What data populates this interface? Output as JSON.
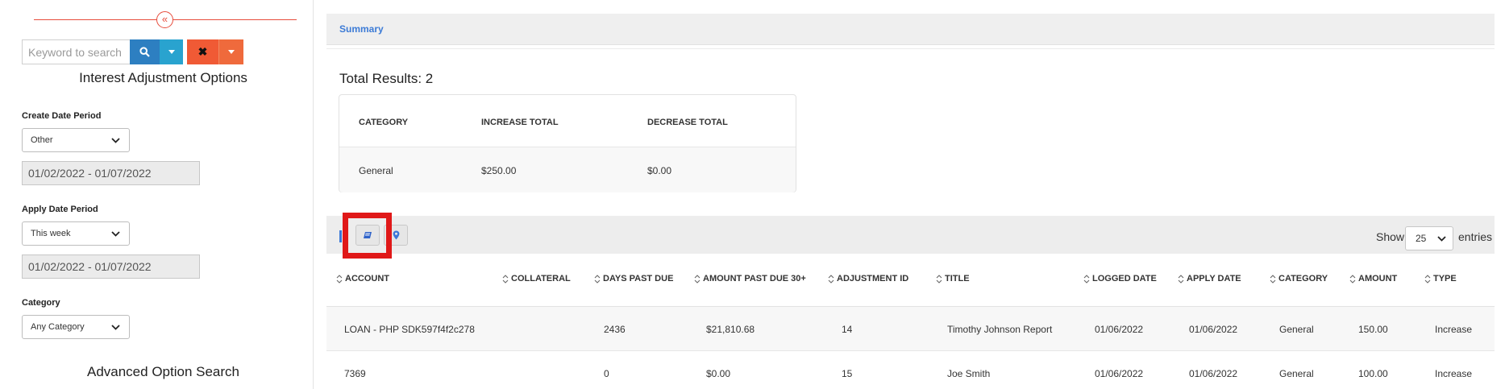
{
  "sidebar": {
    "collapse_glyph": "«",
    "search": {
      "placeholder": "Keyword to search",
      "clear_glyph": "✖"
    },
    "options_heading": "Interest Adjustment Options",
    "create_date": {
      "label": "Create Date Period",
      "selected": "Other",
      "range": "01/02/2022 - 01/07/2022"
    },
    "apply_date": {
      "label": "Apply Date Period",
      "selected": "This week",
      "range": "01/02/2022 - 01/07/2022"
    },
    "category": {
      "label": "Category",
      "selected": "Any Category"
    },
    "advanced_heading": "Advanced Option Search"
  },
  "main": {
    "summary_tab": "Summary",
    "total_results": "Total Results: 2",
    "summary_table": {
      "headers": [
        "CATEGORY",
        "INCREASE TOTAL",
        "DECREASE TOTAL"
      ],
      "row": [
        "General",
        "$250.00",
        "$0.00"
      ]
    },
    "toolbar": {
      "show_label": "Show",
      "entries_value": "25",
      "entries_label": "entries"
    },
    "table": {
      "columns": [
        "ACCOUNT",
        "COLLATERAL",
        "DAYS PAST DUE",
        "AMOUNT PAST DUE 30+",
        "ADJUSTMENT ID",
        "TITLE",
        "LOGGED DATE",
        "APPLY DATE",
        "CATEGORY",
        "AMOUNT",
        "TYPE"
      ],
      "rows": [
        [
          "LOAN - PHP SDK597f4f2c278",
          "",
          "2436",
          "$21,810.68",
          "14",
          "Timothy Johnson Report",
          "01/06/2022",
          "01/06/2022",
          "General",
          "150.00",
          "Increase"
        ],
        [
          "7369",
          "",
          "0",
          "$0.00",
          "15",
          "Joe Smith",
          "01/06/2022",
          "01/06/2022",
          "General",
          "100.00",
          "Increase"
        ]
      ]
    }
  },
  "colors": {
    "accent_blue": "#3c7bd6",
    "search_button": "#2d7fc1",
    "clear_button": "#f05a35",
    "highlight_red": "#e01818"
  }
}
